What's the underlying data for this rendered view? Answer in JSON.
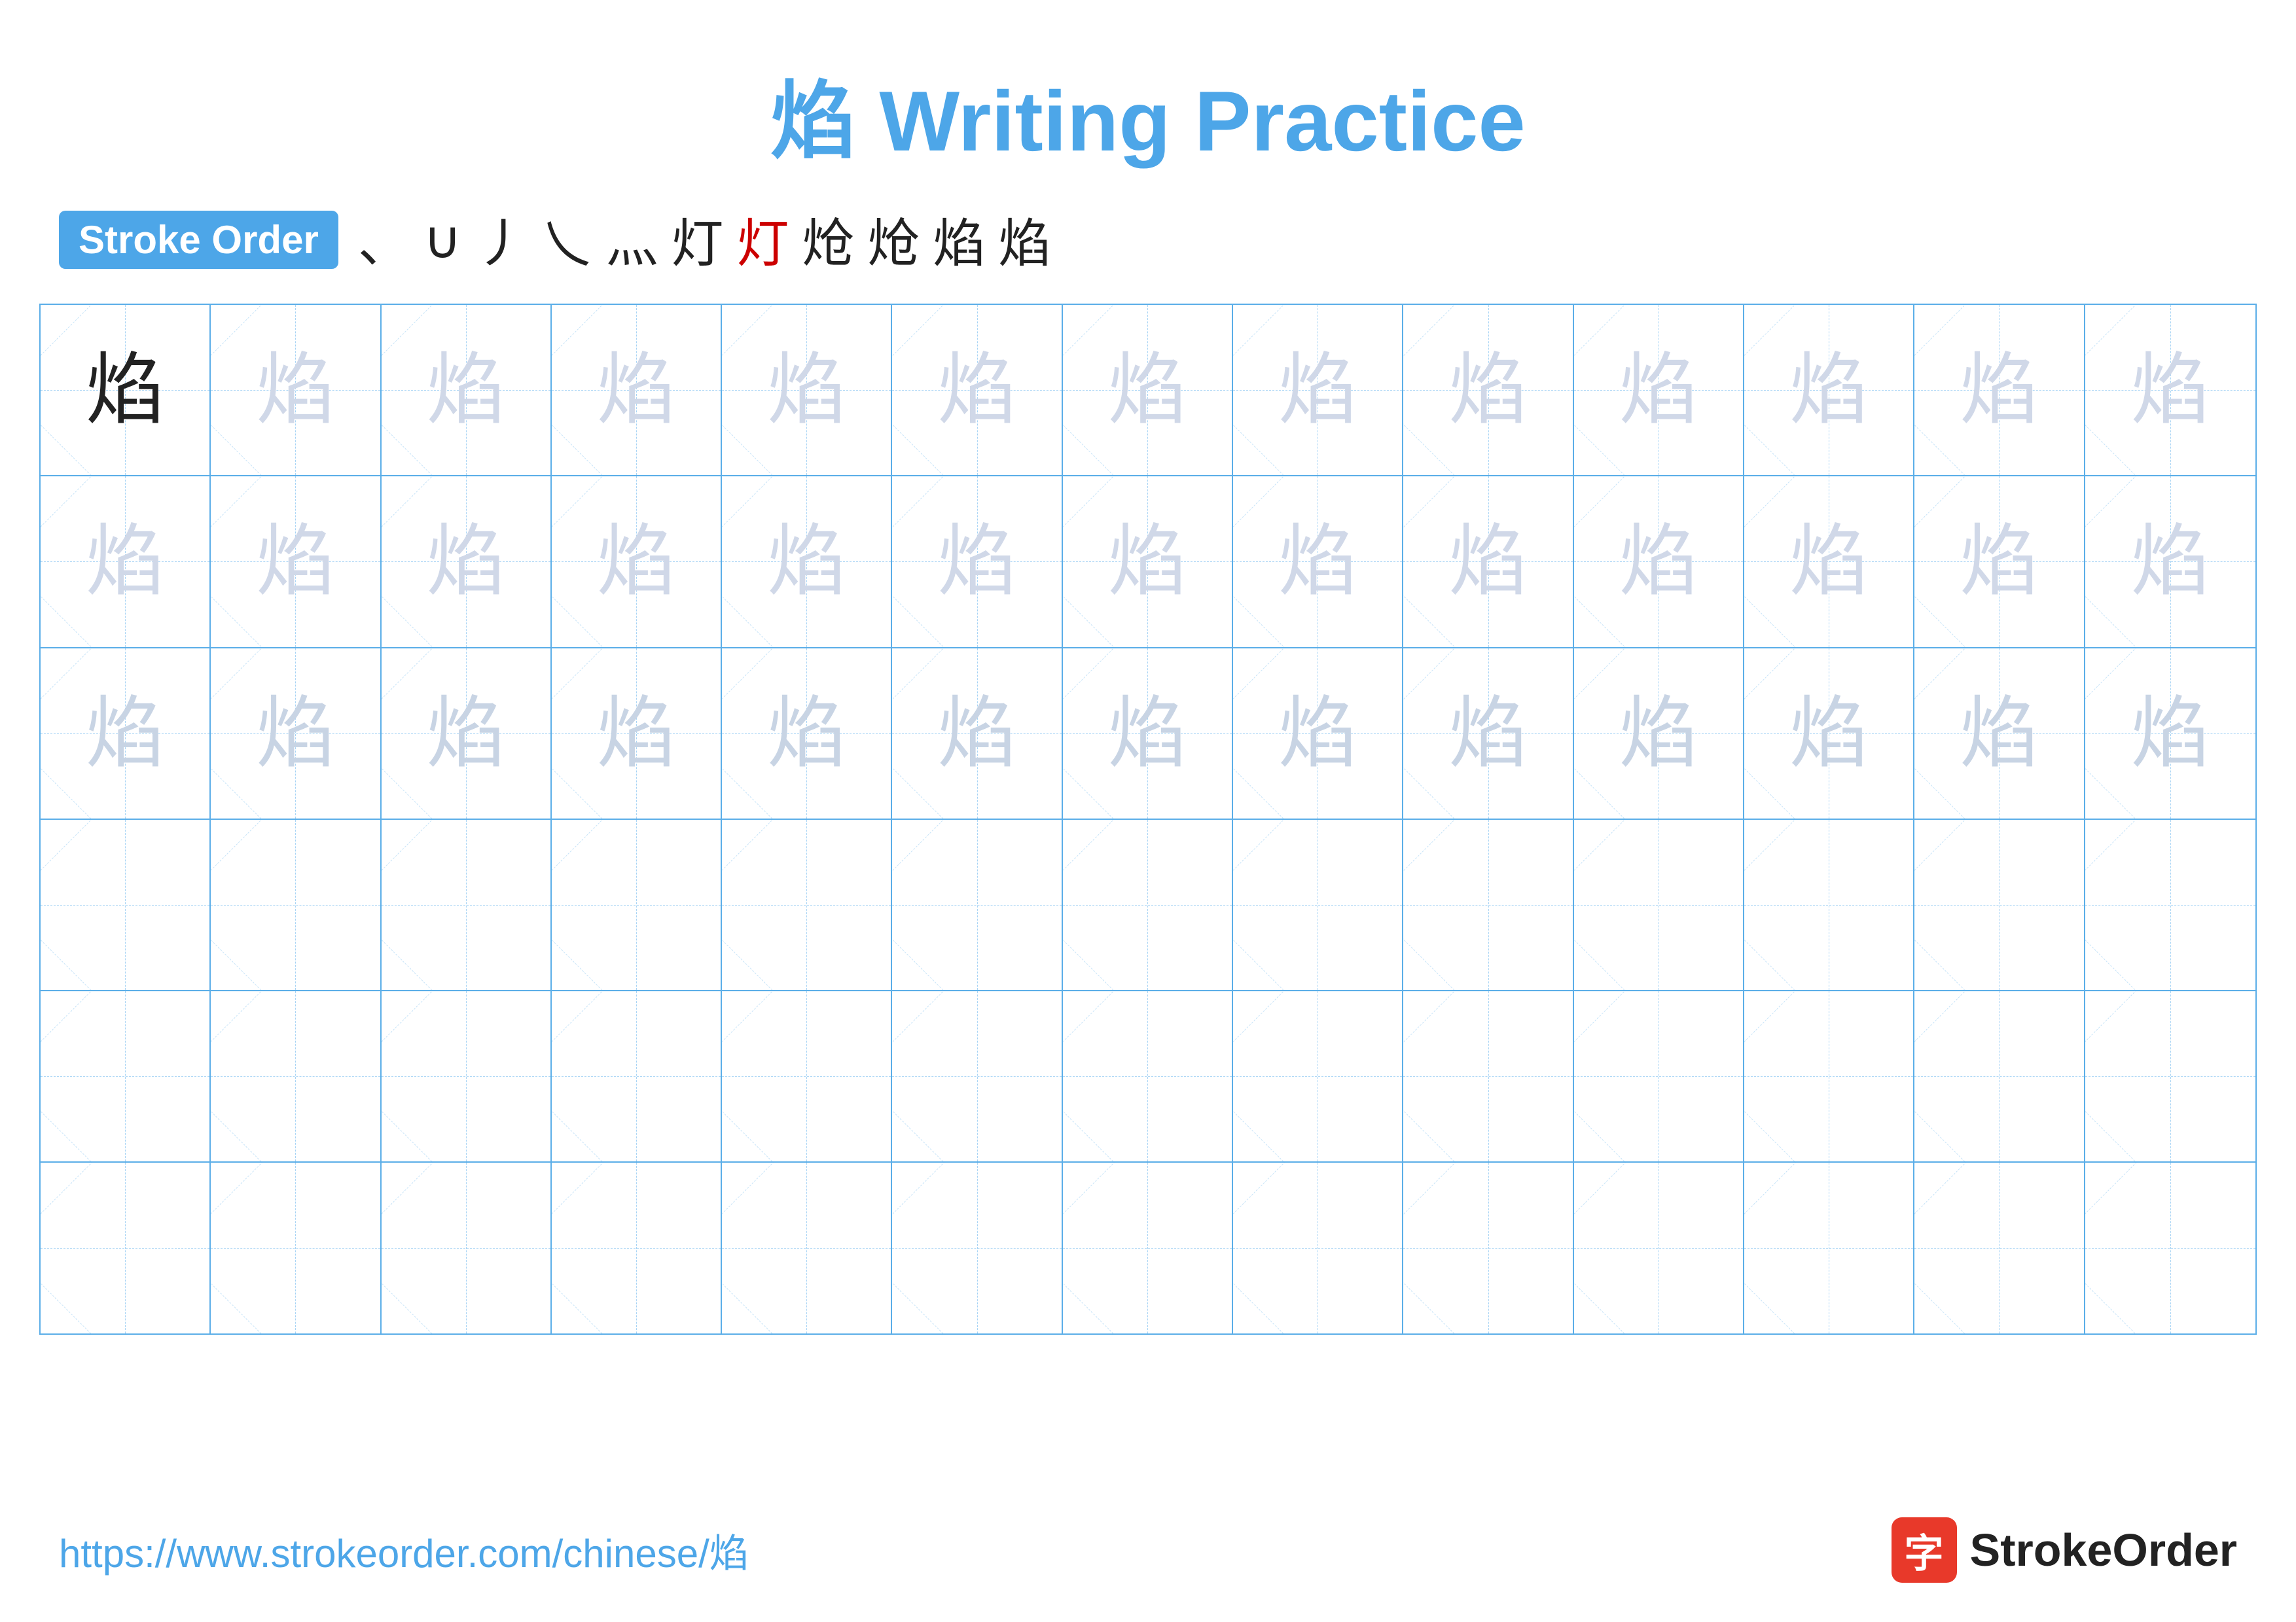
{
  "title": {
    "char": "焰",
    "text": " Writing Practice",
    "full": "焰 Writing Practice"
  },
  "stroke_order": {
    "badge_label": "Stroke Order",
    "strokes": [
      "、",
      "∪",
      "丿",
      "乀",
      "灬",
      "灯",
      "灯",
      "炝",
      "炝",
      "焰",
      "焰"
    ]
  },
  "grid": {
    "rows": 6,
    "cols": 13,
    "char": "焰",
    "row_types": [
      "solid_then_faint",
      "faint",
      "lighter",
      "empty",
      "empty",
      "empty"
    ]
  },
  "footer": {
    "url": "https://www.strokeorder.com/chinese/焰",
    "brand_icon": "字",
    "brand_name": "StrokeOrder"
  }
}
